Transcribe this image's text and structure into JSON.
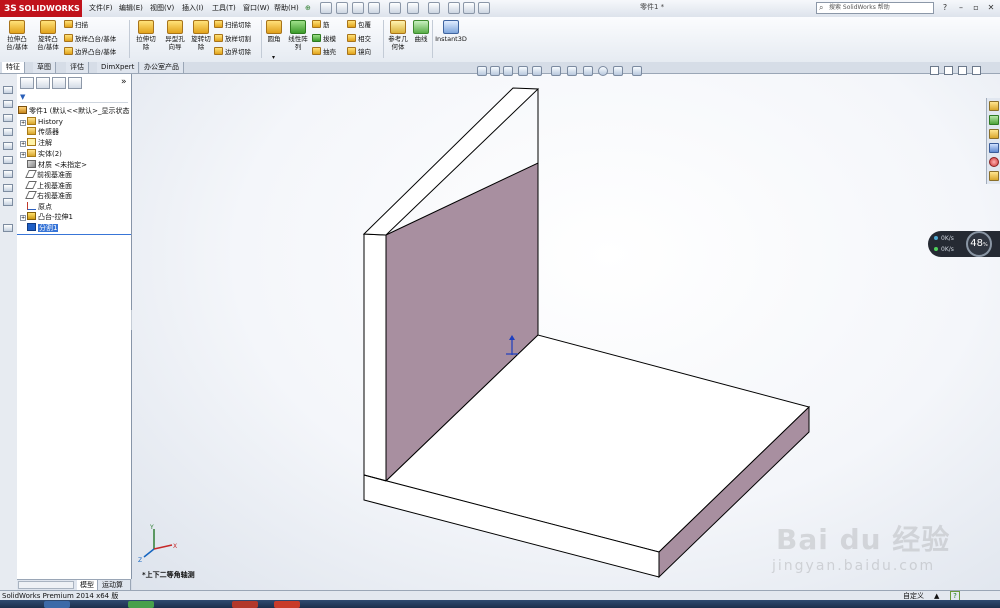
{
  "app": {
    "logo_text": "SOLIDWORKS",
    "logo_mark": "3S",
    "document_title": "零件1 *",
    "search_placeholder": "搜索 SolidWorks 帮助"
  },
  "menu": {
    "items": [
      "文件(F)",
      "编辑(E)",
      "视图(V)",
      "插入(I)",
      "工具(T)",
      "窗口(W)",
      "帮助(H)"
    ],
    "pin": "⊕"
  },
  "window_controls": {
    "help": "?",
    "minimize": "–",
    "restore": "▫",
    "close": "✕"
  },
  "command_manager": {
    "extrude_boss": "拉伸凸\n台/基体",
    "revolve_boss": "旋转凸\n台/基体",
    "sweep": "扫描",
    "loft_boss": "放样凸台/基体",
    "boundary_boss": "边界凸台/基体",
    "extruded_cut": "拉伸切\n除",
    "hole_wizard": "异型孔\n向导",
    "revolved_cut": "旋转切\n除",
    "swept_cut": "扫描切除",
    "lofted_cut": "放样切割",
    "boundary_cut": "边界切除",
    "fillet": "圆角",
    "linear_pattern": "线性阵\n列",
    "rib": "筋",
    "draft": "拔模",
    "shell": "抽壳",
    "wrap": "包覆",
    "intersect": "相交",
    "mirror": "镜向",
    "reference_geometry": "参考几\n何体",
    "curves": "曲线",
    "instant3d": "Instant3D"
  },
  "tabs": [
    "特征",
    "草图",
    "评估",
    "DimXpert",
    "办公室产品"
  ],
  "active_tab": "特征",
  "tree": {
    "filter_icon": "▼",
    "expand_more": "»",
    "root": "零件1 (默认<<默认>_显示状态",
    "nodes": [
      {
        "label": "History",
        "expandable": true,
        "icon": "folder"
      },
      {
        "label": "传感器",
        "expandable": false,
        "icon": "folder"
      },
      {
        "label": "注解",
        "expandable": true,
        "icon": "annotation"
      },
      {
        "label": "实体(2)",
        "expandable": true,
        "icon": "folder"
      },
      {
        "label": "材质 <未指定>",
        "expandable": false,
        "icon": "material"
      },
      {
        "label": "前视基准面",
        "expandable": false,
        "icon": "plane"
      },
      {
        "label": "上视基准面",
        "expandable": false,
        "icon": "plane"
      },
      {
        "label": "右视基准面",
        "expandable": false,
        "icon": "plane"
      },
      {
        "label": "原点",
        "expandable": false,
        "icon": "origin"
      },
      {
        "label": "凸台-拉伸1",
        "expandable": true,
        "icon": "extrude"
      },
      {
        "label": "分割1",
        "expandable": false,
        "icon": "split",
        "selected": true
      }
    ],
    "bottom_tabs": [
      "模型",
      "运动算例1"
    ],
    "active_bottom_tab": "模型"
  },
  "viewport": {
    "view_orientation": "*上下二等角轴测",
    "triad_labels": [
      "Y",
      "X",
      "Z"
    ]
  },
  "network_widget": {
    "upload": "0K/s",
    "download": "0K/s",
    "percent": "48",
    "percent_unit": "%"
  },
  "watermark": {
    "brand": "Bai du 经验",
    "url": "jingyan.baidu.com"
  },
  "status": {
    "product": "SolidWorks Premium 2014 x64 版",
    "units": "自定义",
    "units_arrow": "▲",
    "help_icon": "?"
  },
  "colors": {
    "logo_red": "#c0121b",
    "model_face_shaded": "#a88fa0",
    "model_face_light": "#ffffff",
    "selection_blue": "#3875d7",
    "viewport_bg": "#f4f6fa"
  }
}
